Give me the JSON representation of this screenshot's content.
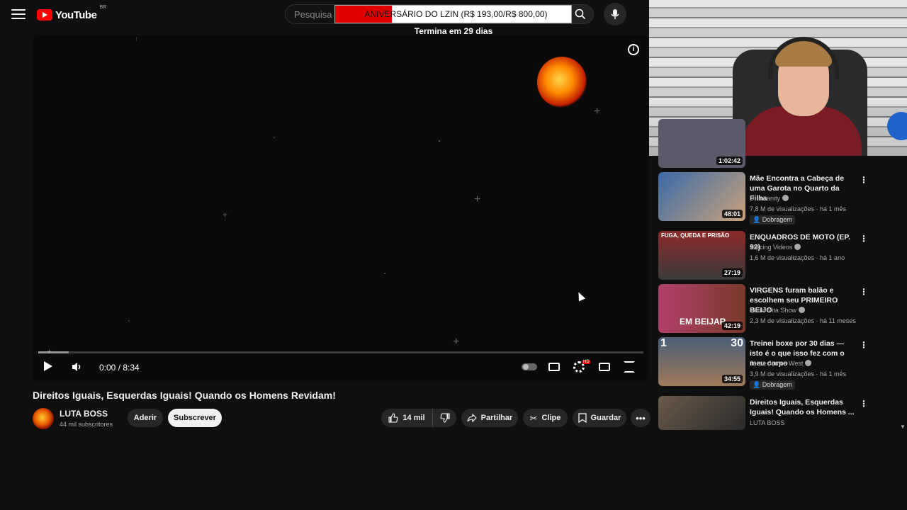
{
  "header": {
    "logo_text": "YouTube",
    "country_code": "BR",
    "search_placeholder": "Pesquisa"
  },
  "donation": {
    "text": "ANIVERSÁRIO DO LZIN (R$ 193,00/R$ 800,00)",
    "subtext": "Termina em 29 dias"
  },
  "player": {
    "time": "0:00 / 8:34",
    "settings_badge": "HD",
    "info_symbol": "i",
    "progress_buffered_fraction": 0.05
  },
  "video": {
    "title": "Direitos Iguais, Esquerdas Iguais! Quando os Homens Revidam!",
    "channel": "LUTA BOSS",
    "subscribers": "44 mil subscritores",
    "join_label": "Aderir",
    "subscribe_label": "Subscrever",
    "likes": "14 mil",
    "share_label": "Partilhar",
    "clip_label": "Clipe",
    "save_label": "Guardar"
  },
  "sidebar": {
    "partial_item": {
      "duration": "1:02:42"
    },
    "items": [
      {
        "title": "Mãe Encontra a Cabeça de uma Garota no Quarto da Filha",
        "channel": "Dr Insanity",
        "meta": "7,8 M de visualizações · há 1 mês",
        "badge": "Dobragem",
        "duration": "48:01",
        "thumb_color": "#3a6aa8"
      },
      {
        "title": "ENQUADROS DE MOTO (EP. 92)",
        "channel": "Xracing Videos",
        "meta": "1,6 M de visualizações · há 1 ano",
        "badge": "",
        "duration": "27:19",
        "thumb_color": "#8e2a2a",
        "thumb_text": "FUGA, QUEDA E PRISÃO"
      },
      {
        "title": "VIRGENS furam balão e escolhem seu PRIMEIRO BEIJO",
        "channel": "Paulo Vita Show",
        "meta": "2,3 M de visualizações · há 11 meses",
        "badge": "",
        "duration": "42:19",
        "thumb_color": "#b23f6b",
        "thumb_text": "EM BEIJAR"
      },
      {
        "title": "Treinei boxe por 30 dias — isto é o que isso fez com o meu corpo",
        "channel": "Jesse James West",
        "meta": "3,9 M de visualizações · há 1 mês",
        "badge": "Dobragem",
        "duration": "34:55",
        "thumb_color": "#4a5e78",
        "thumb_text_left": "1",
        "thumb_text_right": "30"
      },
      {
        "title": "Direitos Iguais, Esquerdas Iguais! Quando os Homens ...",
        "channel": "LUTA BOSS",
        "meta": "",
        "badge": "",
        "duration": "",
        "thumb_color": "#6b5a4a"
      }
    ]
  }
}
